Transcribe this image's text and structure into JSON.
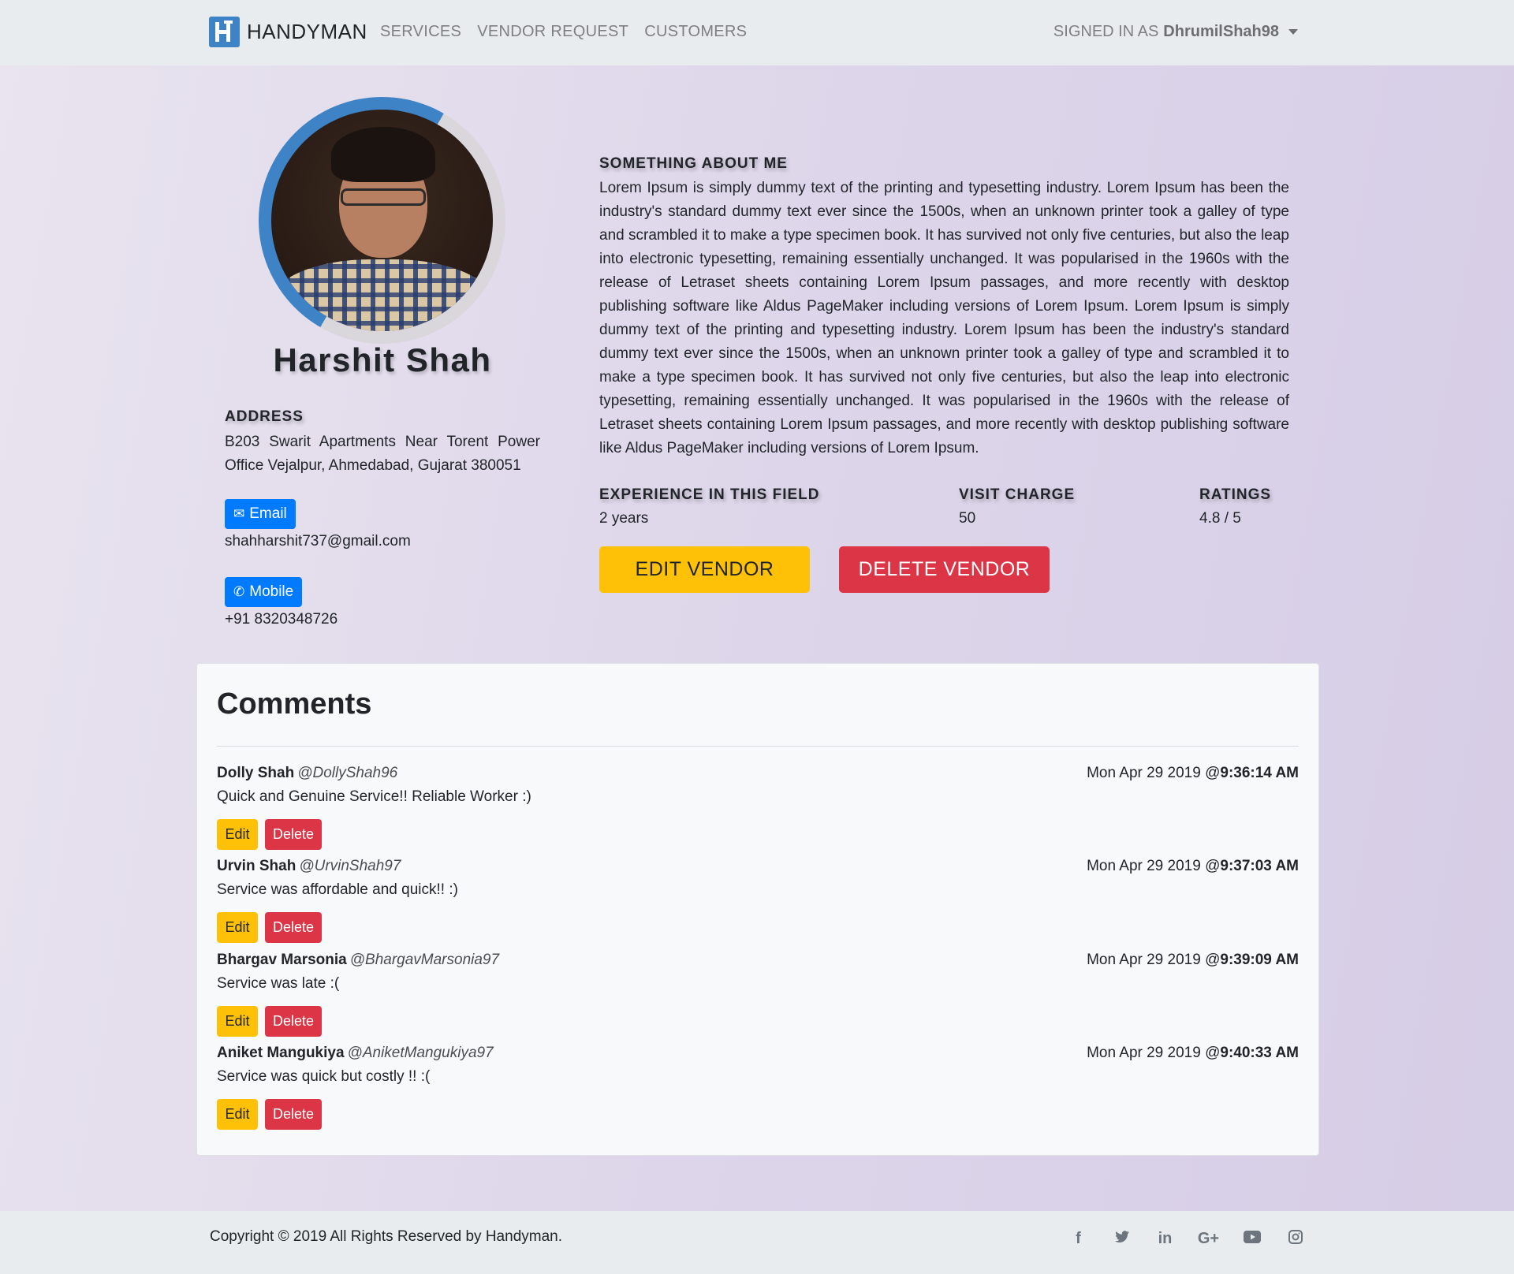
{
  "navbar": {
    "brand": "HANDYMAN",
    "links": [
      "SERVICES",
      "VENDOR REQUEST",
      "CUSTOMERS"
    ],
    "signed_in_prefix": "SIGNED IN AS",
    "username": "DhrumilShah98"
  },
  "profile": {
    "name": "Harshit Shah",
    "address_label": "ADDRESS",
    "address": "B203 Swarit Apartments Near Torent Power Office Vejalpur, Ahmedabad, Gujarat 380051",
    "email_label": "Email",
    "email": "shahharshit737@gmail.com",
    "mobile_label": "Mobile",
    "mobile": "+91 8320348726"
  },
  "about": {
    "label": "SOMETHING ABOUT ME",
    "text": "Lorem Ipsum is simply dummy text of the printing and typesetting industry. Lorem Ipsum has been the industry's standard dummy text ever since the 1500s, when an unknown printer took a galley of type and scrambled it to make a type specimen book. It has survived not only five centuries, but also the leap into electronic typesetting, remaining essentially unchanged. It was popularised in the 1960s with the release of Letraset sheets containing Lorem Ipsum passages, and more recently with desktop publishing software like Aldus PageMaker including versions of Lorem Ipsum. Lorem Ipsum is simply dummy text of the printing and typesetting industry. Lorem Ipsum has been the industry's standard dummy text ever since the 1500s, when an unknown printer took a galley of type and scrambled it to make a type specimen book. It has survived not only five centuries, but also the leap into electronic typesetting, remaining essentially unchanged. It was popularised in the 1960s with the release of Letraset sheets containing Lorem Ipsum passages, and more recently with desktop publishing software like Aldus PageMaker including versions of Lorem Ipsum."
  },
  "stats": {
    "experience_label": "EXPERIENCE IN THIS FIELD",
    "experience": "2 years",
    "visit_label": "VISIT CHARGE",
    "visit": "50",
    "ratings_label": "RATINGS",
    "ratings": "4.8 / 5"
  },
  "actions": {
    "edit_vendor": "EDIT VENDOR",
    "delete_vendor": "DELETE VENDOR"
  },
  "comments": {
    "title": "Comments",
    "edit_label": "Edit",
    "delete_label": "Delete",
    "items": [
      {
        "name": "Dolly Shah",
        "handle": "@DollyShah96",
        "date": "Mon Apr 29 2019 @",
        "time": "9:36:14 AM",
        "text": "Quick and Genuine Service!! Reliable Worker :)"
      },
      {
        "name": "Urvin Shah",
        "handle": "@UrvinShah97",
        "date": "Mon Apr 29 2019 @",
        "time": "9:37:03 AM",
        "text": "Service was affordable and quick!! :)"
      },
      {
        "name": "Bhargav Marsonia",
        "handle": "@BhargavMarsonia97",
        "date": "Mon Apr 29 2019 @",
        "time": "9:39:09 AM",
        "text": "Service was late :("
      },
      {
        "name": "Aniket Mangukiya",
        "handle": "@AniketMangukiya97",
        "date": "Mon Apr 29 2019 @",
        "time": "9:40:33 AM",
        "text": "Service was quick but costly !! :("
      }
    ]
  },
  "footer": {
    "copyright": "Copyright © 2019 All Rights Reserved by Handyman.",
    "social_icons": [
      "facebook-icon",
      "twitter-icon",
      "linkedin-icon",
      "google-plus-icon",
      "youtube-icon",
      "instagram-icon"
    ]
  },
  "colors": {
    "primary": "#007bff",
    "warning": "#ffc107",
    "danger": "#dc3545",
    "brand_blue": "#3d83c5"
  }
}
